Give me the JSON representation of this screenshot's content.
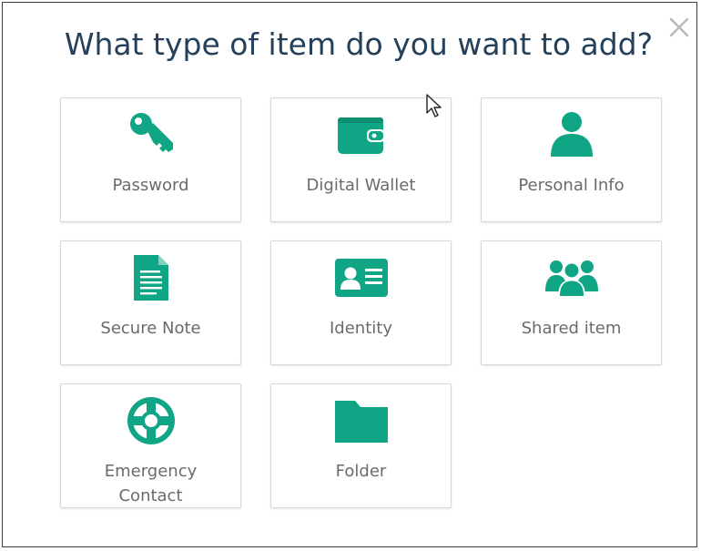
{
  "dialog": {
    "title": "What type of item do you want to add?",
    "close_glyph": "×"
  },
  "accent_color": "#10a585",
  "items": [
    {
      "label": "Password",
      "icon": "key-icon"
    },
    {
      "label": "Digital Wallet",
      "icon": "wallet-icon"
    },
    {
      "label": "Personal Info",
      "icon": "person-icon"
    },
    {
      "label": "Secure Note",
      "icon": "note-icon"
    },
    {
      "label": "Identity",
      "icon": "id-card-icon"
    },
    {
      "label": "Shared item",
      "icon": "group-icon"
    },
    {
      "label_line1": "Emergency",
      "label_line2": "Contact",
      "icon": "lifebuoy-icon"
    },
    {
      "label": "Folder",
      "icon": "folder-icon"
    }
  ]
}
